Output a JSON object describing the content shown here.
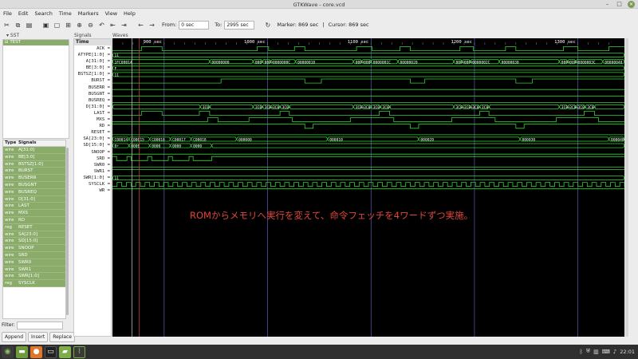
{
  "window": {
    "title": "GTKWave - core.vcd"
  },
  "menu": [
    "File",
    "Edit",
    "Search",
    "Time",
    "Markers",
    "View",
    "Help"
  ],
  "toolbar": {
    "from_label": "From:",
    "from_value": "0 sec",
    "to_label": "To:",
    "to_value": "2995 sec",
    "marker_text": "Marker: 869 sec",
    "separator": "|",
    "cursor_text": "Cursor: 869 sec"
  },
  "sst": {
    "label": "SST",
    "tree_item": "TEST"
  },
  "signal_table": {
    "headers": [
      "Type",
      "Signals"
    ],
    "rows": [
      {
        "type": "wire",
        "name": "A[31:0]"
      },
      {
        "type": "wire",
        "name": "BE[3:0]"
      },
      {
        "type": "wire",
        "name": "BSTSZ[1:0]"
      },
      {
        "type": "wire",
        "name": "BURST"
      },
      {
        "type": "wire",
        "name": "BUSERR"
      },
      {
        "type": "wire",
        "name": "BUSGNT"
      },
      {
        "type": "wire",
        "name": "BUSREQ"
      },
      {
        "type": "wire",
        "name": "D[31:0]"
      },
      {
        "type": "wire",
        "name": "LAST"
      },
      {
        "type": "wire",
        "name": "MXS"
      },
      {
        "type": "wire",
        "name": "RD"
      },
      {
        "type": "reg",
        "name": "RESET"
      },
      {
        "type": "wire",
        "name": "SA[23:0]"
      },
      {
        "type": "wire",
        "name": "SD[15:0]"
      },
      {
        "type": "wire",
        "name": "SNOOP"
      },
      {
        "type": "wire",
        "name": "SRD"
      },
      {
        "type": "wire",
        "name": "SWR0"
      },
      {
        "type": "wire",
        "name": "SWR1"
      },
      {
        "type": "wire",
        "name": "SWR[1:0]"
      },
      {
        "type": "reg",
        "name": "SYSCLK"
      }
    ]
  },
  "filter": {
    "label": "Filter:",
    "value": ""
  },
  "buttons": {
    "append": "Append",
    "insert": "Insert",
    "replace": "Replace"
  },
  "panels": {
    "signals": "Signals",
    "waves": "Waves"
  },
  "signal_names": {
    "time_header": "Time",
    "names": [
      "ACK =",
      "ATYPE[1:0] =",
      "A[31:0] =",
      "BE[3:0] =",
      "BSTSZ[1:0] =",
      "BURST =",
      "BUSERR =",
      "BUSGNT =",
      "BUSREQ =",
      "D[31:0] =",
      "LAST =",
      "MXS =",
      "RD =",
      "RESET =",
      "SA[23:0] =",
      "SD[15:0] =",
      "SNOOP =",
      "SRD =",
      "SWR0 =",
      "SWR1 =",
      "SWR[1:0] =",
      "SYSCLK =",
      "WR ="
    ]
  },
  "waves": {
    "time_ticks": [
      {
        "t": 900,
        "label": "900 sec"
      },
      {
        "t": 1000,
        "label": "1000 sec"
      },
      {
        "t": 1100,
        "label": "1100 sec"
      },
      {
        "t": 1200,
        "label": "1200 sec"
      },
      {
        "t": 1300,
        "label": "1300 sec"
      }
    ],
    "bus_values": {
      "atype": "11",
      "a_start": "1FC00014",
      "a_1": "00000000",
      "a_2": "000+",
      "a_3": "000+",
      "a_4": "0000000C",
      "a_5": "00000010",
      "a_6": "0000001C",
      "a_7": "00000020",
      "a_8": "0000002C",
      "a_9": "00000030",
      "a_10": "0000003C",
      "a_11": "00000040",
      "be": "F",
      "bstsz": "11",
      "d_val": "3C0+",
      "sa_1": "C00014",
      "sa_2": "C00015",
      "sa_3": "C00016",
      "sa_4": "C00017",
      "sa_5": "C00018",
      "sa_6": "000000",
      "sa_7": "000010",
      "sa_8": "000020",
      "sa_9": "000030",
      "sa_10": "000040",
      "sd_1": "0+",
      "sd_2": "000E",
      "sd_3": "0000",
      "sd_4": "0000",
      "sd_5": "0000",
      "swr": "11"
    },
    "annotation": "ROMからメモリへ実行を変えて、命令フェッチを4ワードずつ実施。",
    "colors": {
      "trace": "#34d234",
      "bus": "#34d234",
      "tick": "#6a6ad8",
      "marker": "#d0d0d0",
      "cursor": "#d8505a",
      "annotation": "#e0463c"
    }
  },
  "taskbar": {
    "clock": "22:01",
    "icons": [
      "mint-menu-icon",
      "files-icon",
      "firefox-icon",
      "terminal-icon",
      "folder-icon",
      "gtkwave-icon"
    ]
  }
}
